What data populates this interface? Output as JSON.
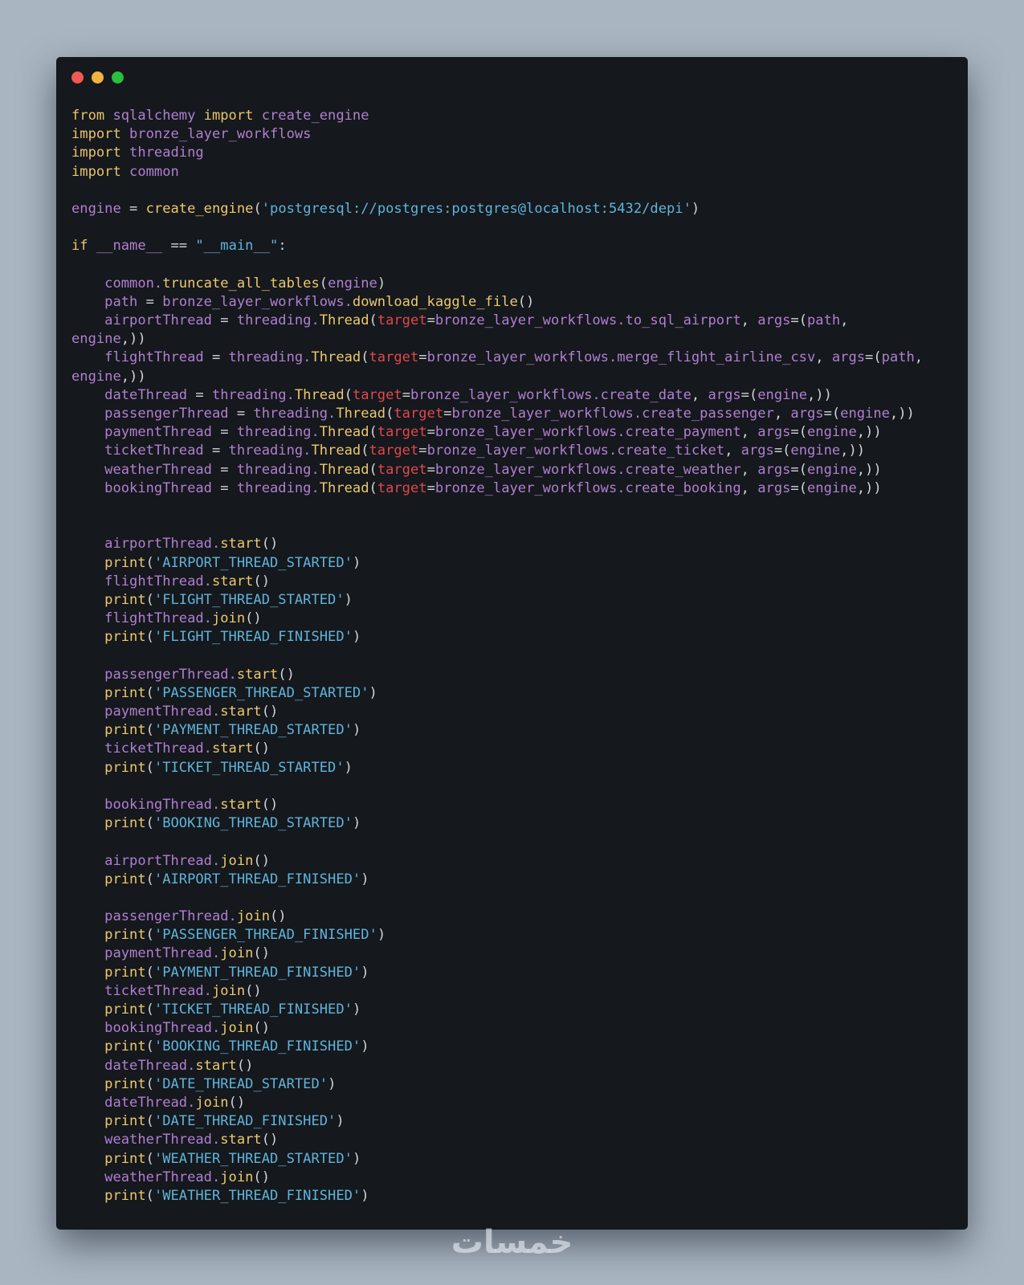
{
  "window": {
    "controls": [
      {
        "name": "close",
        "color": "#ee5a52"
      },
      {
        "name": "minimize",
        "color": "#f2b33d"
      },
      {
        "name": "maximize",
        "color": "#29c03e"
      }
    ]
  },
  "code": {
    "lines": [
      [
        [
          "keyword",
          "from"
        ],
        [
          "plain",
          " sqlalchemy "
        ],
        [
          "keyword",
          "import"
        ],
        [
          "plain",
          " create_engine"
        ]
      ],
      [
        [
          "keyword",
          "import"
        ],
        [
          "plain",
          " bronze_layer_workflows"
        ]
      ],
      [
        [
          "keyword",
          "import"
        ],
        [
          "plain",
          " threading"
        ]
      ],
      [
        [
          "keyword",
          "import"
        ],
        [
          "plain",
          " common"
        ]
      ],
      [],
      [
        [
          "plain",
          "engine "
        ],
        [
          "op",
          "= "
        ],
        [
          "func",
          "create_engine"
        ],
        [
          "op",
          "("
        ],
        [
          "string",
          "'postgresql://postgres:postgres@localhost:5432/depi'"
        ],
        [
          "op",
          ")"
        ]
      ],
      [],
      [
        [
          "keyword",
          "if"
        ],
        [
          "plain",
          " __name__ "
        ],
        [
          "op",
          "=="
        ],
        [
          "plain",
          " "
        ],
        [
          "string",
          "\"__main__\""
        ],
        [
          "op",
          ":"
        ]
      ],
      [],
      [
        [
          "plain",
          "    common."
        ],
        [
          "func",
          "truncate_all_tables"
        ],
        [
          "op",
          "("
        ],
        [
          "plain",
          "engine"
        ],
        [
          "op",
          ")"
        ]
      ],
      [
        [
          "plain",
          "    path "
        ],
        [
          "op",
          "= "
        ],
        [
          "plain",
          "bronze_layer_workflows."
        ],
        [
          "func",
          "download_kaggle_file"
        ],
        [
          "op",
          "()"
        ]
      ],
      [
        [
          "plain",
          "    airportThread "
        ],
        [
          "op",
          "= "
        ],
        [
          "plain",
          "threading."
        ],
        [
          "func",
          "Thread"
        ],
        [
          "op",
          "("
        ],
        [
          "kwarg",
          "target"
        ],
        [
          "op",
          "="
        ],
        [
          "plain",
          "bronze_layer_workflows.to_sql_airport"
        ],
        [
          "op",
          ", "
        ],
        [
          "plain",
          "args"
        ],
        [
          "op",
          "=("
        ],
        [
          "plain",
          "path"
        ],
        [
          "op",
          ","
        ]
      ],
      [
        [
          "plain",
          "engine"
        ],
        [
          "op",
          ",))"
        ]
      ],
      [
        [
          "plain",
          "    flightThread "
        ],
        [
          "op",
          "= "
        ],
        [
          "plain",
          "threading."
        ],
        [
          "func",
          "Thread"
        ],
        [
          "op",
          "("
        ],
        [
          "kwarg",
          "target"
        ],
        [
          "op",
          "="
        ],
        [
          "plain",
          "bronze_layer_workflows.merge_flight_airline_csv"
        ],
        [
          "op",
          ", "
        ],
        [
          "plain",
          "args"
        ],
        [
          "op",
          "=("
        ],
        [
          "plain",
          "path"
        ],
        [
          "op",
          ","
        ]
      ],
      [
        [
          "plain",
          "engine"
        ],
        [
          "op",
          ",))"
        ]
      ],
      [
        [
          "plain",
          "    dateThread "
        ],
        [
          "op",
          "= "
        ],
        [
          "plain",
          "threading."
        ],
        [
          "func",
          "Thread"
        ],
        [
          "op",
          "("
        ],
        [
          "kwarg",
          "target"
        ],
        [
          "op",
          "="
        ],
        [
          "plain",
          "bronze_layer_workflows.create_date"
        ],
        [
          "op",
          ", "
        ],
        [
          "plain",
          "args"
        ],
        [
          "op",
          "=("
        ],
        [
          "plain",
          "engine"
        ],
        [
          "op",
          ",))"
        ]
      ],
      [
        [
          "plain",
          "    passengerThread "
        ],
        [
          "op",
          "= "
        ],
        [
          "plain",
          "threading."
        ],
        [
          "func",
          "Thread"
        ],
        [
          "op",
          "("
        ],
        [
          "kwarg",
          "target"
        ],
        [
          "op",
          "="
        ],
        [
          "plain",
          "bronze_layer_workflows.create_passenger"
        ],
        [
          "op",
          ", "
        ],
        [
          "plain",
          "args"
        ],
        [
          "op",
          "=("
        ],
        [
          "plain",
          "engine"
        ],
        [
          "op",
          ",))"
        ]
      ],
      [
        [
          "plain",
          "    paymentThread "
        ],
        [
          "op",
          "= "
        ],
        [
          "plain",
          "threading."
        ],
        [
          "func",
          "Thread"
        ],
        [
          "op",
          "("
        ],
        [
          "kwarg",
          "target"
        ],
        [
          "op",
          "="
        ],
        [
          "plain",
          "bronze_layer_workflows.create_payment"
        ],
        [
          "op",
          ", "
        ],
        [
          "plain",
          "args"
        ],
        [
          "op",
          "=("
        ],
        [
          "plain",
          "engine"
        ],
        [
          "op",
          ",))"
        ]
      ],
      [
        [
          "plain",
          "    ticketThread "
        ],
        [
          "op",
          "= "
        ],
        [
          "plain",
          "threading."
        ],
        [
          "func",
          "Thread"
        ],
        [
          "op",
          "("
        ],
        [
          "kwarg",
          "target"
        ],
        [
          "op",
          "="
        ],
        [
          "plain",
          "bronze_layer_workflows.create_ticket"
        ],
        [
          "op",
          ", "
        ],
        [
          "plain",
          "args"
        ],
        [
          "op",
          "=("
        ],
        [
          "plain",
          "engine"
        ],
        [
          "op",
          ",))"
        ]
      ],
      [
        [
          "plain",
          "    weatherThread "
        ],
        [
          "op",
          "= "
        ],
        [
          "plain",
          "threading."
        ],
        [
          "func",
          "Thread"
        ],
        [
          "op",
          "("
        ],
        [
          "kwarg",
          "target"
        ],
        [
          "op",
          "="
        ],
        [
          "plain",
          "bronze_layer_workflows.create_weather"
        ],
        [
          "op",
          ", "
        ],
        [
          "plain",
          "args"
        ],
        [
          "op",
          "=("
        ],
        [
          "plain",
          "engine"
        ],
        [
          "op",
          ",))"
        ]
      ],
      [
        [
          "plain",
          "    bookingThread "
        ],
        [
          "op",
          "= "
        ],
        [
          "plain",
          "threading."
        ],
        [
          "func",
          "Thread"
        ],
        [
          "op",
          "("
        ],
        [
          "kwarg",
          "target"
        ],
        [
          "op",
          "="
        ],
        [
          "plain",
          "bronze_layer_workflows.create_booking"
        ],
        [
          "op",
          ", "
        ],
        [
          "plain",
          "args"
        ],
        [
          "op",
          "=("
        ],
        [
          "plain",
          "engine"
        ],
        [
          "op",
          ",))"
        ]
      ],
      [],
      [],
      [
        [
          "plain",
          "    airportThread."
        ],
        [
          "func",
          "start"
        ],
        [
          "op",
          "()"
        ]
      ],
      [
        [
          "plain",
          "    "
        ],
        [
          "func",
          "print"
        ],
        [
          "op",
          "("
        ],
        [
          "string",
          "'AIRPORT_THREAD_STARTED'"
        ],
        [
          "op",
          ")"
        ]
      ],
      [
        [
          "plain",
          "    flightThread."
        ],
        [
          "func",
          "start"
        ],
        [
          "op",
          "()"
        ]
      ],
      [
        [
          "plain",
          "    "
        ],
        [
          "func",
          "print"
        ],
        [
          "op",
          "("
        ],
        [
          "string",
          "'FLIGHT_THREAD_STARTED'"
        ],
        [
          "op",
          ")"
        ]
      ],
      [
        [
          "plain",
          "    flightThread."
        ],
        [
          "func",
          "join"
        ],
        [
          "op",
          "()"
        ]
      ],
      [
        [
          "plain",
          "    "
        ],
        [
          "func",
          "print"
        ],
        [
          "op",
          "("
        ],
        [
          "string",
          "'FLIGHT_THREAD_FINISHED'"
        ],
        [
          "op",
          ")"
        ]
      ],
      [],
      [
        [
          "plain",
          "    passengerThread."
        ],
        [
          "func",
          "start"
        ],
        [
          "op",
          "()"
        ]
      ],
      [
        [
          "plain",
          "    "
        ],
        [
          "func",
          "print"
        ],
        [
          "op",
          "("
        ],
        [
          "string",
          "'PASSENGER_THREAD_STARTED'"
        ],
        [
          "op",
          ")"
        ]
      ],
      [
        [
          "plain",
          "    paymentThread."
        ],
        [
          "func",
          "start"
        ],
        [
          "op",
          "()"
        ]
      ],
      [
        [
          "plain",
          "    "
        ],
        [
          "func",
          "print"
        ],
        [
          "op",
          "("
        ],
        [
          "string",
          "'PAYMENT_THREAD_STARTED'"
        ],
        [
          "op",
          ")"
        ]
      ],
      [
        [
          "plain",
          "    ticketThread."
        ],
        [
          "func",
          "start"
        ],
        [
          "op",
          "()"
        ]
      ],
      [
        [
          "plain",
          "    "
        ],
        [
          "func",
          "print"
        ],
        [
          "op",
          "("
        ],
        [
          "string",
          "'TICKET_THREAD_STARTED'"
        ],
        [
          "op",
          ")"
        ]
      ],
      [],
      [
        [
          "plain",
          "    bookingThread."
        ],
        [
          "func",
          "start"
        ],
        [
          "op",
          "()"
        ]
      ],
      [
        [
          "plain",
          "    "
        ],
        [
          "func",
          "print"
        ],
        [
          "op",
          "("
        ],
        [
          "string",
          "'BOOKING_THREAD_STARTED'"
        ],
        [
          "op",
          ")"
        ]
      ],
      [],
      [
        [
          "plain",
          "    airportThread."
        ],
        [
          "func",
          "join"
        ],
        [
          "op",
          "()"
        ]
      ],
      [
        [
          "plain",
          "    "
        ],
        [
          "func",
          "print"
        ],
        [
          "op",
          "("
        ],
        [
          "string",
          "'AIRPORT_THREAD_FINISHED'"
        ],
        [
          "op",
          ")"
        ]
      ],
      [],
      [
        [
          "plain",
          "    passengerThread."
        ],
        [
          "func",
          "join"
        ],
        [
          "op",
          "()"
        ]
      ],
      [
        [
          "plain",
          "    "
        ],
        [
          "func",
          "print"
        ],
        [
          "op",
          "("
        ],
        [
          "string",
          "'PASSENGER_THREAD_FINISHED'"
        ],
        [
          "op",
          ")"
        ]
      ],
      [
        [
          "plain",
          "    paymentThread."
        ],
        [
          "func",
          "join"
        ],
        [
          "op",
          "()"
        ]
      ],
      [
        [
          "plain",
          "    "
        ],
        [
          "func",
          "print"
        ],
        [
          "op",
          "("
        ],
        [
          "string",
          "'PAYMENT_THREAD_FINISHED'"
        ],
        [
          "op",
          ")"
        ]
      ],
      [
        [
          "plain",
          "    ticketThread."
        ],
        [
          "func",
          "join"
        ],
        [
          "op",
          "()"
        ]
      ],
      [
        [
          "plain",
          "    "
        ],
        [
          "func",
          "print"
        ],
        [
          "op",
          "("
        ],
        [
          "string",
          "'TICKET_THREAD_FINISHED'"
        ],
        [
          "op",
          ")"
        ]
      ],
      [
        [
          "plain",
          "    bookingThread."
        ],
        [
          "func",
          "join"
        ],
        [
          "op",
          "()"
        ]
      ],
      [
        [
          "plain",
          "    "
        ],
        [
          "func",
          "print"
        ],
        [
          "op",
          "("
        ],
        [
          "string",
          "'BOOKING_THREAD_FINISHED'"
        ],
        [
          "op",
          ")"
        ]
      ],
      [
        [
          "plain",
          "    dateThread."
        ],
        [
          "func",
          "start"
        ],
        [
          "op",
          "()"
        ]
      ],
      [
        [
          "plain",
          "    "
        ],
        [
          "func",
          "print"
        ],
        [
          "op",
          "("
        ],
        [
          "string",
          "'DATE_THREAD_STARTED'"
        ],
        [
          "op",
          ")"
        ]
      ],
      [
        [
          "plain",
          "    dateThread."
        ],
        [
          "func",
          "join"
        ],
        [
          "op",
          "()"
        ]
      ],
      [
        [
          "plain",
          "    "
        ],
        [
          "func",
          "print"
        ],
        [
          "op",
          "("
        ],
        [
          "string",
          "'DATE_THREAD_FINISHED'"
        ],
        [
          "op",
          ")"
        ]
      ],
      [
        [
          "plain",
          "    weatherThread."
        ],
        [
          "func",
          "start"
        ],
        [
          "op",
          "()"
        ]
      ],
      [
        [
          "plain",
          "    "
        ],
        [
          "func",
          "print"
        ],
        [
          "op",
          "("
        ],
        [
          "string",
          "'WEATHER_THREAD_STARTED'"
        ],
        [
          "op",
          ")"
        ]
      ],
      [
        [
          "plain",
          "    weatherThread."
        ],
        [
          "func",
          "join"
        ],
        [
          "op",
          "()"
        ]
      ],
      [
        [
          "plain",
          "    "
        ],
        [
          "func",
          "print"
        ],
        [
          "op",
          "("
        ],
        [
          "string",
          "'WEATHER_THREAD_FINISHED'"
        ],
        [
          "op",
          ")"
        ]
      ]
    ]
  },
  "watermark": {
    "text": "خمسات"
  }
}
